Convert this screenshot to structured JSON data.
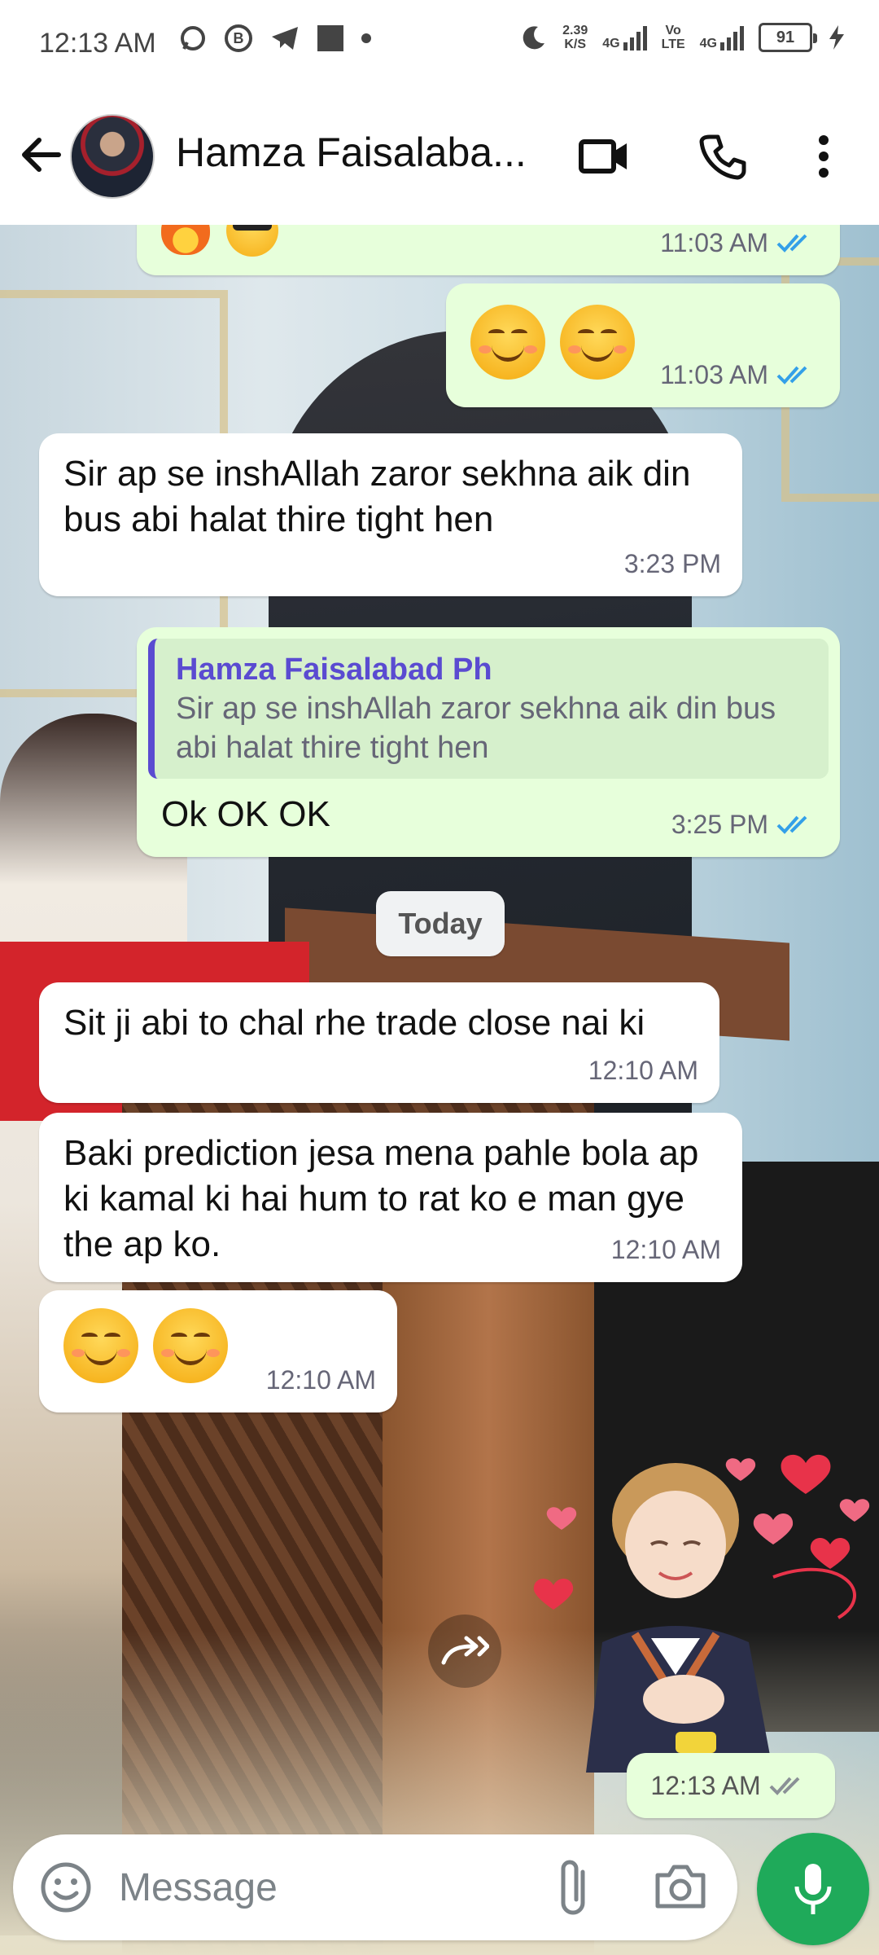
{
  "status_bar": {
    "time": "12:13 AM",
    "speed_value": "2.39",
    "speed_unit": "K/S",
    "net1": "4G",
    "volte": "Vo",
    "volte2": "LTE",
    "net2": "4G",
    "battery": "91"
  },
  "header": {
    "contact_name": "Hamza Faisalaba..."
  },
  "messages": [
    {
      "time": "11:03 AM"
    },
    {
      "time": "11:03 AM"
    },
    {
      "text": "Sir ap se inshAllah zaror sekhna aik din bus abi halat thire tight hen",
      "time": "3:23 PM"
    },
    {
      "quote_author": "Hamza Faisalabad Ph",
      "quote_text": "Sir ap se inshAllah zaror sekhna aik din bus abi halat thire tight hen",
      "text": "Ok OK OK",
      "time": "3:25 PM"
    },
    {
      "text": "Sit ji abi to chal rhe trade close nai ki",
      "time": "12:10 AM"
    },
    {
      "text": "Baki prediction jesa mena pahle bola ap ki kamal ki hai hum to rat ko e man gye the ap ko.",
      "time": "12:10 AM"
    },
    {
      "time": "12:10 AM"
    },
    {
      "time": "12:13 AM"
    }
  ],
  "day_divider": "Today",
  "composer": {
    "placeholder": "Message"
  },
  "colors": {
    "outgoing_bubble": "#e7ffdb",
    "incoming_bubble": "#ffffff",
    "read_tick": "#34a0e8",
    "mic_button": "#1faa5a",
    "quote_accent": "#5a4bd1"
  }
}
